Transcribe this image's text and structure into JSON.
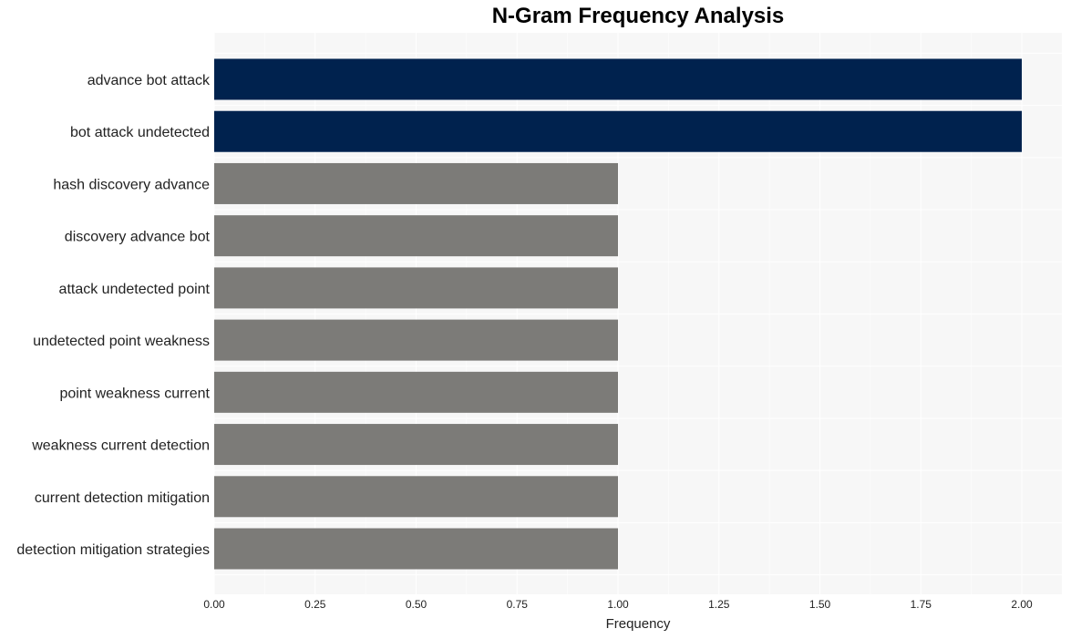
{
  "chart_data": {
    "type": "bar",
    "orientation": "horizontal",
    "title": "N-Gram Frequency Analysis",
    "xlabel": "Frequency",
    "ylabel": "",
    "categories": [
      "advance bot attack",
      "bot attack undetected",
      "hash discovery advance",
      "discovery advance bot",
      "attack undetected point",
      "undetected point weakness",
      "point weakness current",
      "weakness current detection",
      "current detection mitigation",
      "detection mitigation strategies"
    ],
    "values": [
      2,
      2,
      1,
      1,
      1,
      1,
      1,
      1,
      1,
      1
    ],
    "xlim": [
      0,
      2.1
    ],
    "xticks": [
      "0.00",
      "0.25",
      "0.50",
      "0.75",
      "1.00",
      "1.25",
      "1.50",
      "1.75",
      "2.00"
    ],
    "grid": true,
    "colors": {
      "max": "#00224e",
      "other": "#7c7b78",
      "plot_bg": "#f7f7f7",
      "grid": "#ffffff"
    }
  }
}
